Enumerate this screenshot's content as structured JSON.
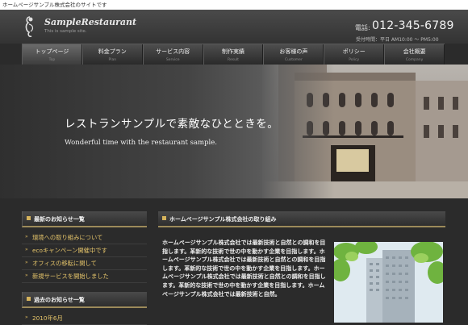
{
  "topbar": {
    "text": "ホームページサンプル株式会社のサイトです"
  },
  "header": {
    "logo_title": "SampleRestaurant",
    "logo_sub": "This is sample site.",
    "tel_label": "電話:",
    "tel_number": "012-345-6789",
    "hours": "受付時間：平日 AM10:00 ～ PM5:00"
  },
  "nav": {
    "items": [
      {
        "label": "トップページ",
        "sub": "Top"
      },
      {
        "label": "料金プラン",
        "sub": "Plan"
      },
      {
        "label": "サービス内容",
        "sub": "Service"
      },
      {
        "label": "制作実績",
        "sub": "Result"
      },
      {
        "label": "お客様の声",
        "sub": "Customer"
      },
      {
        "label": "ポリシー",
        "sub": "Policy"
      },
      {
        "label": "会社概要",
        "sub": "Company"
      }
    ]
  },
  "hero": {
    "title": "レストランサンプルで素敵なひとときを。",
    "subtitle": "Wonderful time with the restaurant sample."
  },
  "sidebar": {
    "news_title": "最新のお知らせ一覧",
    "news_items": [
      "環境への取り組みについて",
      "ecoキャンペーン開催中です",
      "オフィスの移転に関して",
      "新規サービスを開始しました"
    ],
    "archive_title": "過去のお知らせ一覧",
    "archive_items": [
      "2010年6月"
    ]
  },
  "main": {
    "title": "ホームページサンプル株式会社の取り組み",
    "body": "ホームページサンプル株式会社では最新技術と自然との調和を目指します。革新的な技術で世の中を動かす企業を目指します。ホームページサンプル株式会社では最新技術と自然との調和を目指します。革新的な技術で世の中を動かす企業を目指します。ホームページサンプル株式会社では最新技術と自然との調和を目指します。革新的な技術で世の中を動かす企業を目指します。ホームページサンプル株式会社では最新技術と自然。"
  },
  "colors": {
    "accent_gold": "#d5b35c",
    "link_gold": "#e5c46a",
    "background": "#2b2b2b"
  },
  "icons": {
    "logo": "chef-figure-icon",
    "news_bullet": "square-bullet-icon",
    "list_arrow": "arrow-right-icon"
  }
}
